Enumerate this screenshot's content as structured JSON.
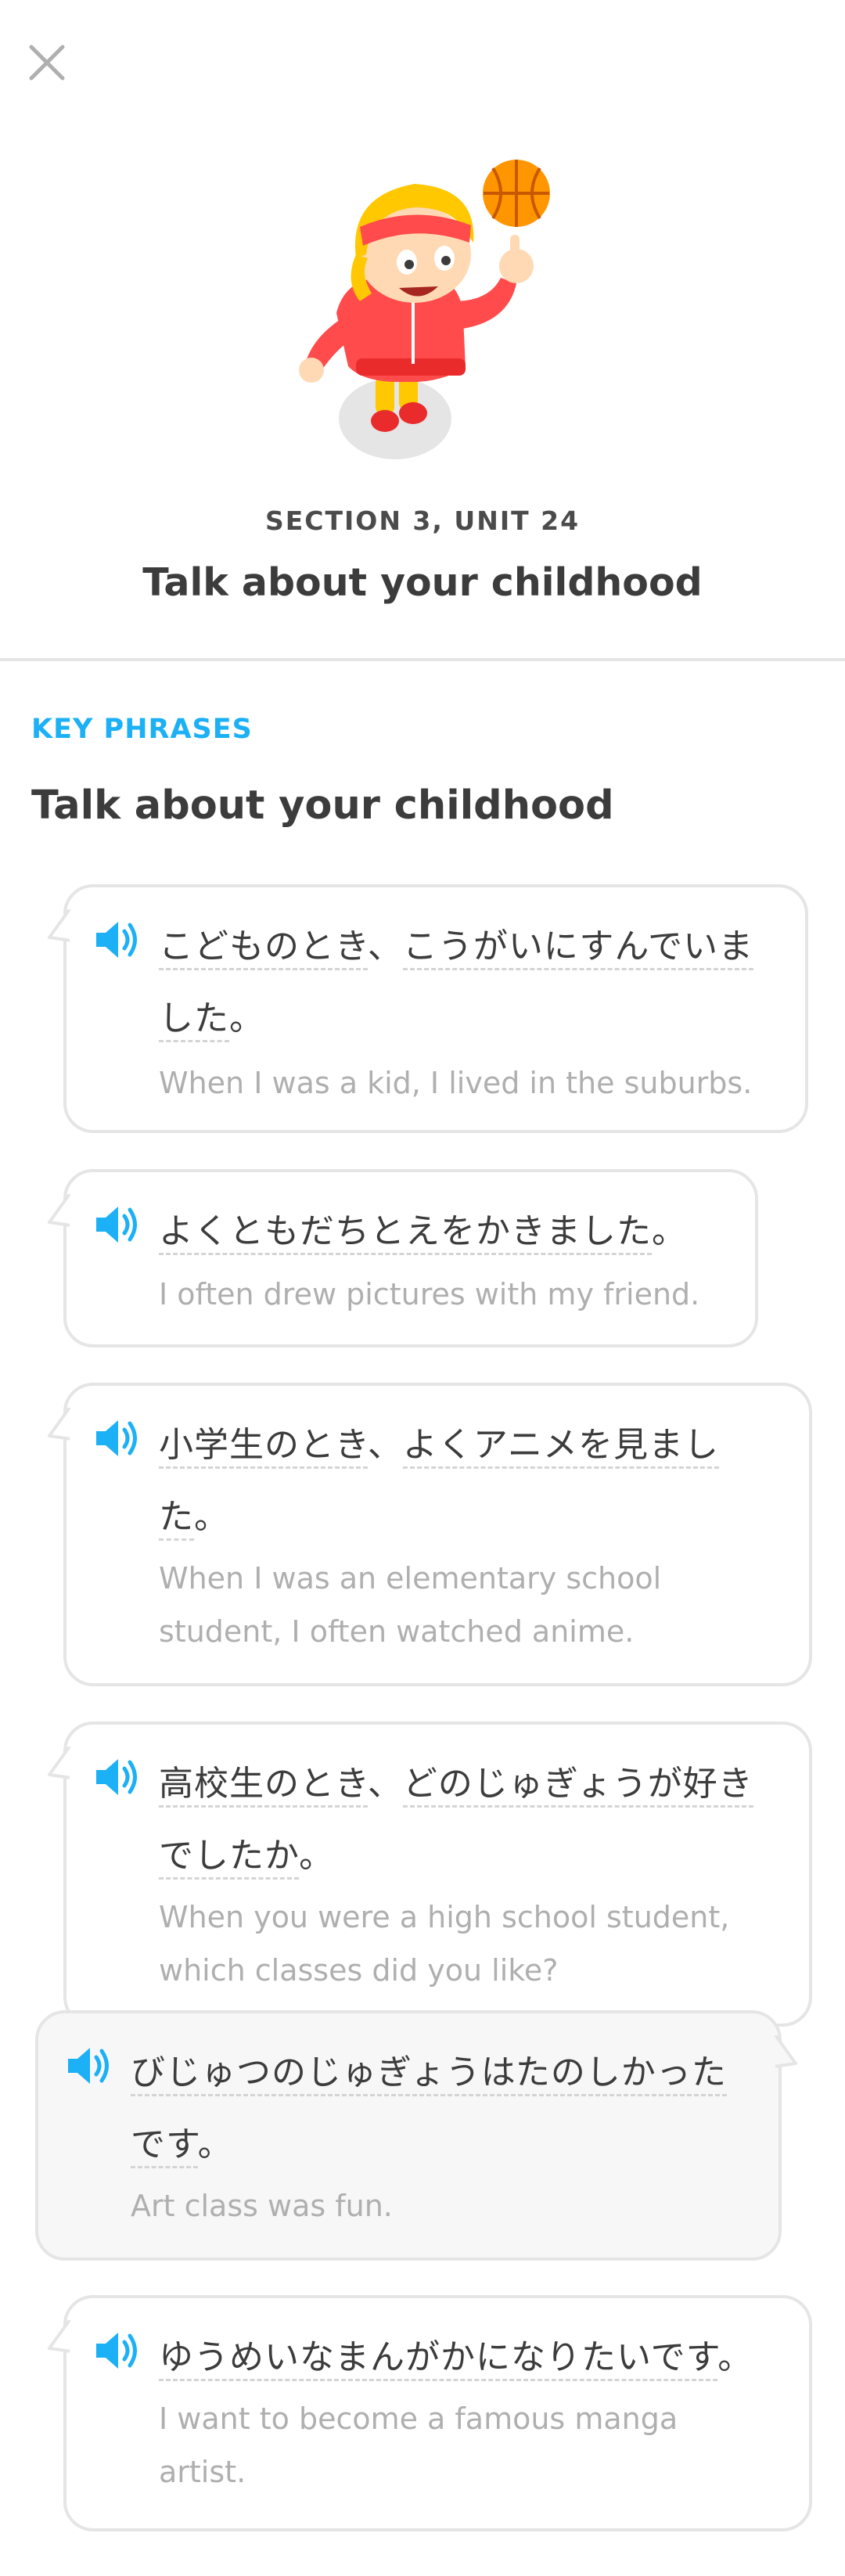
{
  "header": {
    "section_label": "SECTION 3, UNIT 24",
    "unit_title": "Talk about your childhood"
  },
  "content": {
    "key_phrases_label": "KEY PHRASES",
    "group_title": "Talk about your childhood"
  },
  "phrases": [
    {
      "jp_line1_w1": "こどものとき",
      "jp_line1_sep": "、",
      "jp_line1_w2": "こうがいにすんでいま",
      "jp_line2_w1": "した",
      "jp_line2_end": "。",
      "en_line1": "When I was a kid, I lived in the suburbs."
    },
    {
      "jp_line1_w1": "よくともだちとえをかきました",
      "jp_line1_end": "。",
      "en_line1": "I often drew pictures with my friend."
    },
    {
      "jp_line1_w1": "小学生のとき",
      "jp_line1_sep": "、",
      "jp_line1_w2": "よくアニメを見まし",
      "jp_line2_w1": "た",
      "jp_line2_end": "。",
      "en_line1": "When I was an elementary school",
      "en_line2": "student, I often watched anime."
    },
    {
      "jp_line1_w1": "高校生のとき",
      "jp_line1_sep": "、",
      "jp_line1_w2": "どのじゅぎょうが好き",
      "jp_line2_w1": "でしたか",
      "jp_line2_end": "。",
      "en_line1": "When you were a high school student,",
      "en_line2": "which classes did you like?"
    },
    {
      "jp_line1_w1": "びじゅつのじゅぎょうはたのしかった",
      "jp_line2_w1": "です",
      "jp_line2_end": "。",
      "en_line1": "Art class was fun."
    },
    {
      "jp_line1_w1": "ゆうめいなまんがかになりたいです",
      "jp_line1_end": "。",
      "en_line1": "I want to become a famous manga",
      "en_line2": "artist."
    }
  ],
  "icons": {
    "close": "close-icon",
    "speaker": "speaker-icon"
  },
  "colors": {
    "accent": "#1cb0f6",
    "text": "#3c3c3c",
    "muted": "#afafaf",
    "border": "#e5e5e5"
  }
}
